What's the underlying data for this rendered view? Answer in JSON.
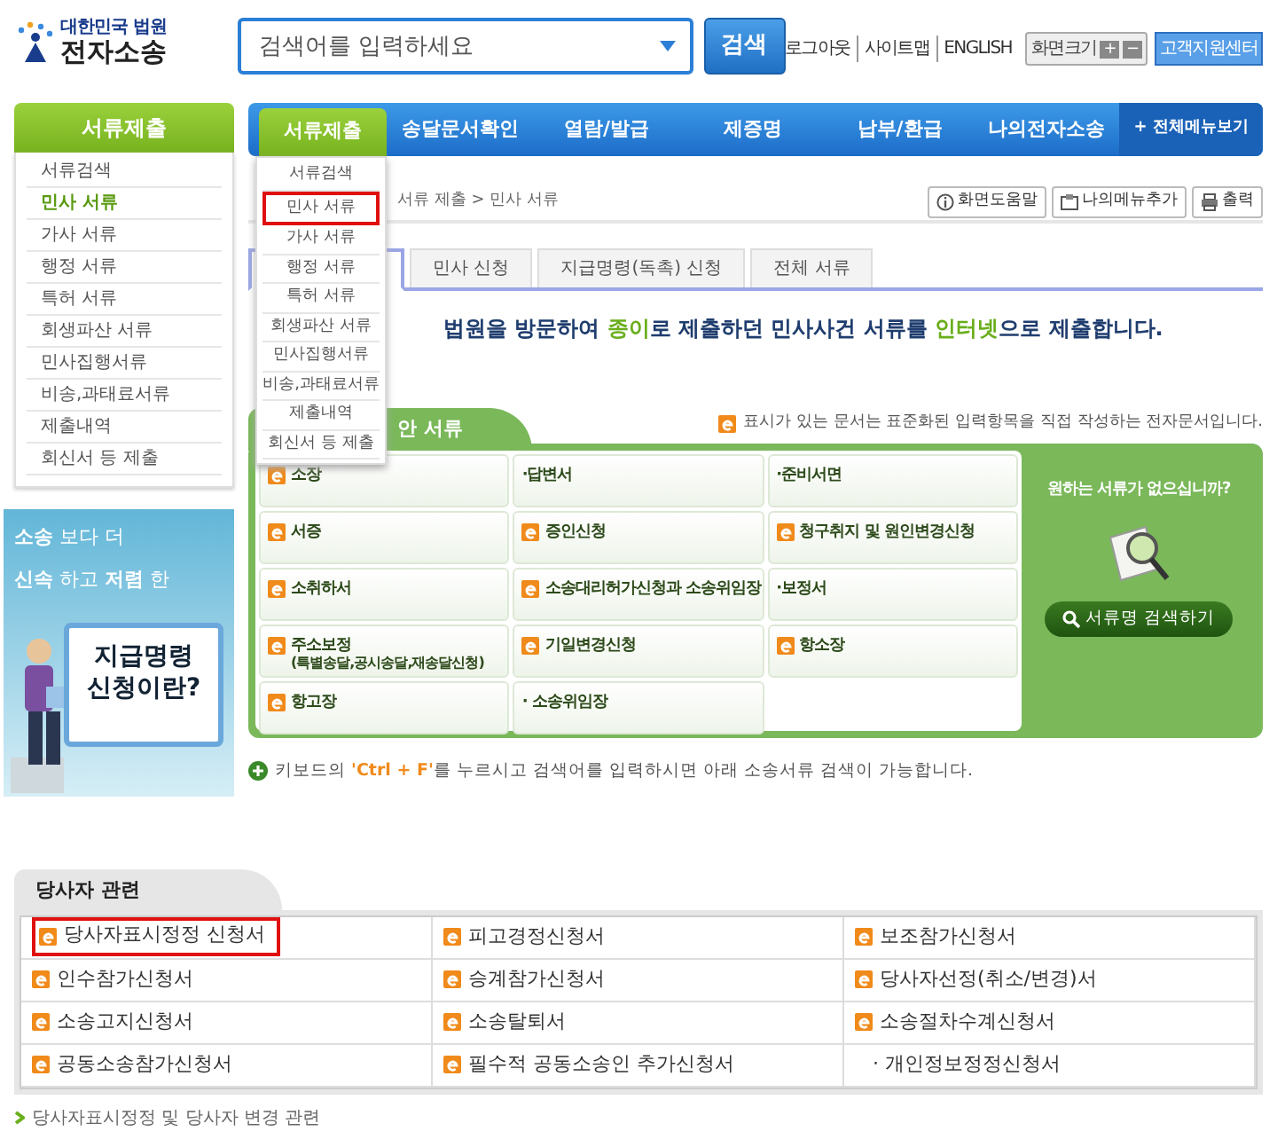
{
  "logo": {
    "org": "대한민국 법원",
    "title": "전자소송"
  },
  "search": {
    "placeholder": "검색어를 입력하세요",
    "button": "검색"
  },
  "top_links": [
    "로그아웃",
    "사이트맵",
    "ENGLISH"
  ],
  "font_size": {
    "label": "화면크기",
    "plus": "+",
    "minus": "−"
  },
  "support_button": "고객지원센터",
  "nav": [
    {
      "label": "서류제출",
      "selected": true
    },
    {
      "label": "송달문서확인",
      "selected": false
    },
    {
      "label": "열람/발급",
      "selected": false
    },
    {
      "label": "제증명",
      "selected": false
    },
    {
      "label": "납부/환급",
      "selected": false
    },
    {
      "label": "나의전자소송",
      "selected": false
    }
  ],
  "all_menu": "+ 전체메뉴보기",
  "sidebar": {
    "title": "서류제출",
    "items": [
      {
        "label": "서류검색",
        "selected": false
      },
      {
        "label": "민사 서류",
        "selected": true
      },
      {
        "label": "가사 서류",
        "selected": false
      },
      {
        "label": "행정 서류",
        "selected": false
      },
      {
        "label": "특허 서류",
        "selected": false
      },
      {
        "label": "회생파산 서류",
        "selected": false
      },
      {
        "label": "민사집행서류",
        "selected": false
      },
      {
        "label": "비송,과태료서류",
        "selected": false
      },
      {
        "label": "제출내역",
        "selected": false
      },
      {
        "label": "회신서 등 제출",
        "selected": false
      }
    ]
  },
  "dropdown": {
    "items": [
      {
        "label": "서류검색",
        "highlighted": false
      },
      {
        "label": "민사 서류",
        "highlighted": true
      },
      {
        "label": "가사 서류",
        "highlighted": false
      },
      {
        "label": "행정 서류",
        "highlighted": false
      },
      {
        "label": "특허 서류",
        "highlighted": false
      },
      {
        "label": "회생파산 서류",
        "highlighted": false
      },
      {
        "label": "민사집행서류",
        "highlighted": false
      },
      {
        "label": "비송,과태료서류",
        "highlighted": false
      },
      {
        "label": "제출내역",
        "highlighted": false
      },
      {
        "label": "회신서 등 제출",
        "highlighted": false
      }
    ]
  },
  "banner": {
    "lines": [
      "**소송** 보다 더",
      "**신속** 하고 **저렴** 한"
    ],
    "card": [
      "지급명령",
      "신청이란?"
    ]
  },
  "breadcrumb": "서류 제출 > 민사 서류",
  "tools": [
    {
      "kind": "help",
      "label": "화면도움말"
    },
    {
      "kind": "addmenu",
      "label": "나의메뉴추가"
    },
    {
      "kind": "print",
      "label": "출력"
    }
  ],
  "tabs": [
    {
      "selected": true
    },
    {
      "label": "민사 신청",
      "selected": false
    },
    {
      "label": "지급명령(독촉) 신청",
      "selected": false
    },
    {
      "label": "전체 서류",
      "selected": false
    }
  ],
  "intro": [
    {
      "text": "법원을 방문하여 ",
      "highlight": false
    },
    {
      "text": "종이",
      "highlight": true
    },
    {
      "text": "로 제출하던 민사사건 서류를 ",
      "highlight": false
    },
    {
      "text": "인터넷",
      "highlight": true
    },
    {
      "text": "으로 제출합니다.",
      "highlight": false
    }
  ],
  "legend": "표시가 있는 문서는 표준화된 입력항목을 직접 작성하는 전자문서입니다.",
  "panel": {
    "title": "안 서류",
    "items": [
      {
        "kind": "eform",
        "label": "소장"
      },
      {
        "kind": "plain",
        "label": "·답변서"
      },
      {
        "kind": "plain",
        "label": "·준비서면"
      },
      {
        "kind": "eform",
        "label": "서증"
      },
      {
        "kind": "eform",
        "label": "증인신청"
      },
      {
        "kind": "eform",
        "label": "청구취지 및 원인변경신청"
      },
      {
        "kind": "eform",
        "label": "소취하서"
      },
      {
        "kind": "eform",
        "label": "소송대리허가신청과 소송위임장"
      },
      {
        "kind": "plain",
        "label": "·보정서"
      },
      {
        "kind": "eform",
        "label": "주소보정",
        "note": "(특별송달,공시송달,재송달신청)"
      },
      {
        "kind": "eform",
        "label": "기일변경신청"
      },
      {
        "kind": "eform",
        "label": "항소장"
      },
      {
        "kind": "eform",
        "label": "항고장"
      },
      {
        "kind": "plain",
        "label": "· 소송위임장"
      }
    ],
    "side_question": "원하는 서류가 없으십니까?",
    "side_button": "서류명 검색하기"
  },
  "hint": [
    {
      "text": "키보드의 ",
      "highlight": false
    },
    {
      "text": "'Ctrl + F'",
      "highlight": true
    },
    {
      "text": "를 누르시고 검색어를 입력하시면 아래 소송서류 검색이 가능합니다.",
      "highlight": false
    }
  ],
  "party": {
    "title": "당사자 관련",
    "items": [
      {
        "kind": "eform",
        "label": "당사자표시정정 신청서",
        "highlighted": true
      },
      {
        "kind": "eform",
        "label": "피고경정신청서",
        "highlighted": false
      },
      {
        "kind": "eform",
        "label": "보조참가신청서",
        "highlighted": false
      },
      {
        "kind": "eform",
        "label": "인수참가신청서",
        "highlighted": false
      },
      {
        "kind": "eform",
        "label": "승계참가신청서",
        "highlighted": false
      },
      {
        "kind": "eform",
        "label": "당사자선정(취소/변경)서",
        "highlighted": false
      },
      {
        "kind": "eform",
        "label": "소송고지신청서",
        "highlighted": false
      },
      {
        "kind": "eform",
        "label": "소송탈퇴서",
        "highlighted": false
      },
      {
        "kind": "eform",
        "label": "소송절차수계신청서",
        "highlighted": false
      },
      {
        "kind": "eform",
        "label": "공동소송참가신청서",
        "highlighted": false
      },
      {
        "kind": "eform",
        "label": "필수적 공동소송인 추가신청서",
        "highlighted": false
      },
      {
        "kind": "plain",
        "label": "· 개인정보정정신청서",
        "highlighted": false
      }
    ],
    "link": "당사자표시정정 및 당사자 변경 관련"
  }
}
